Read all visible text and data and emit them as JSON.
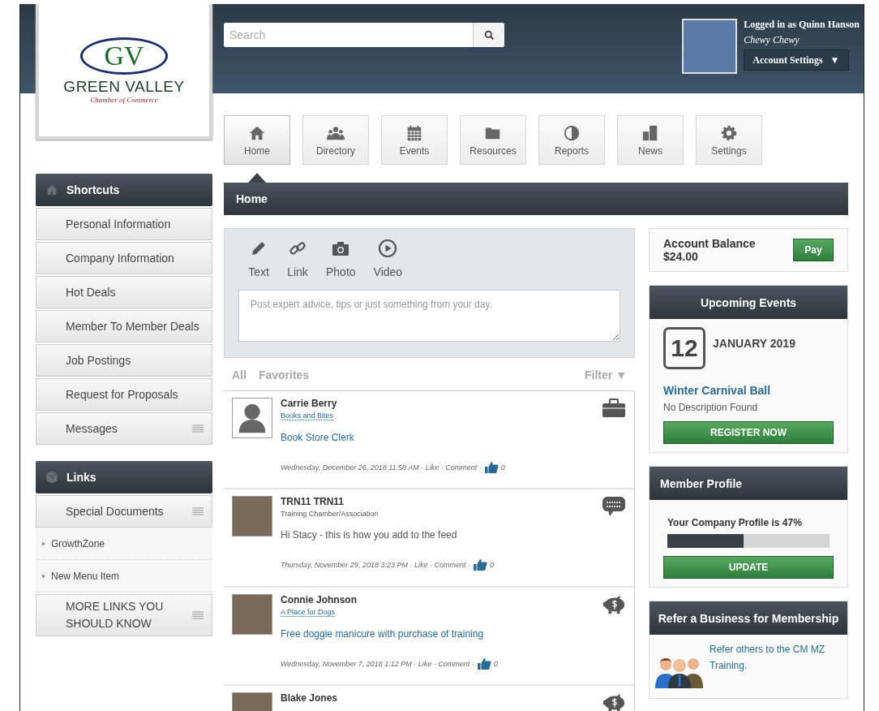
{
  "logo": {
    "monogram": "GV",
    "name": "GREEN VALLEY",
    "tagline": "Chamber of Commerce"
  },
  "search": {
    "placeholder": "Search"
  },
  "user": {
    "logged_in": "Logged in as Quinn Hanson",
    "company": "Chewy Chewy",
    "menu_label": "Account Settings",
    "caret": "▼"
  },
  "nav": [
    {
      "label": "Home",
      "kind": "home",
      "selected": true
    },
    {
      "label": "Directory",
      "kind": "people",
      "selected": false
    },
    {
      "label": "Events",
      "kind": "calendar",
      "selected": false
    },
    {
      "label": "Resources",
      "kind": "folder",
      "selected": false
    },
    {
      "label": "Reports",
      "kind": "pie",
      "selected": false
    },
    {
      "label": "News",
      "kind": "buildings",
      "selected": false
    },
    {
      "label": "Settings",
      "kind": "gear",
      "selected": false
    }
  ],
  "page_title": "Home",
  "shortcuts": {
    "title": "Shortcuts",
    "items": [
      {
        "label": "Personal Information",
        "has_menu": false
      },
      {
        "label": "Company Information",
        "has_menu": false
      },
      {
        "label": "Hot Deals",
        "has_menu": false
      },
      {
        "label": "Member To Member Deals",
        "has_menu": false
      },
      {
        "label": "Job Postings",
        "has_menu": false
      },
      {
        "label": "Request for Proposals",
        "has_menu": false
      },
      {
        "label": "Messages",
        "has_menu": true
      }
    ]
  },
  "links": {
    "title": "Links",
    "items": [
      {
        "label": "Special Documents",
        "has_menu": true,
        "children": [
          {
            "label": "GrowthZone"
          },
          {
            "label": "New Menu Item"
          }
        ]
      },
      {
        "label": "MORE LINKS YOU SHOULD KNOW",
        "has_menu": true
      }
    ]
  },
  "composer": {
    "tools": [
      {
        "label": "Text",
        "kind": "pencil"
      },
      {
        "label": "Link",
        "kind": "link"
      },
      {
        "label": "Photo",
        "kind": "camera"
      },
      {
        "label": "Video",
        "kind": "play"
      }
    ],
    "placeholder": "Post expert advice, tips or just something from your day."
  },
  "feed_filters": {
    "tabs": [
      "All",
      "Favorites"
    ],
    "filter": "Filter",
    "caret": "▼"
  },
  "posts": [
    {
      "name": "Carrie Berry",
      "company": "Books and Bites",
      "kind": "job",
      "photo": false,
      "message": "Book Store Clerk",
      "meta": "Wednesday, December 26, 2018 11:58 AM · Like · Comment ·",
      "likes": "0"
    },
    {
      "name": "TRN11 TRN11",
      "company": "Training Chamber/Association",
      "kind": "status",
      "photo": true,
      "message": "Hi Stacy - this is how you add to the feed",
      "meta": "Thursday, November 29, 2018 3:23 PM · Like · Comment ·",
      "likes": "0"
    },
    {
      "name": "Connie Johnson",
      "company": "A Place for Dogs",
      "kind": "deal",
      "photo": true,
      "message": "Free doggie manicure with purchase of training",
      "meta": "Wednesday, November 7, 2018 1:12 PM · Like · Comment ·",
      "likes": "0"
    },
    {
      "name": "Blake Jones",
      "kind": "deal",
      "photo": true
    }
  ],
  "account": {
    "label": "Account Balance",
    "amount": "$24.00",
    "button": "Pay"
  },
  "events": {
    "title": "Upcoming Events",
    "day": "12",
    "month": "JANUARY 2019",
    "name": "Winter Carnival Ball",
    "description": "No Description Found",
    "button": "REGISTER NOW"
  },
  "profile": {
    "title": "Member Profile",
    "text": "Your Company Profile is 47%",
    "level": 0.47,
    "button": "UPDATE"
  },
  "refer": {
    "title": "Refer a Business for Membership",
    "text": "Refer others to the CM MZ Training."
  }
}
